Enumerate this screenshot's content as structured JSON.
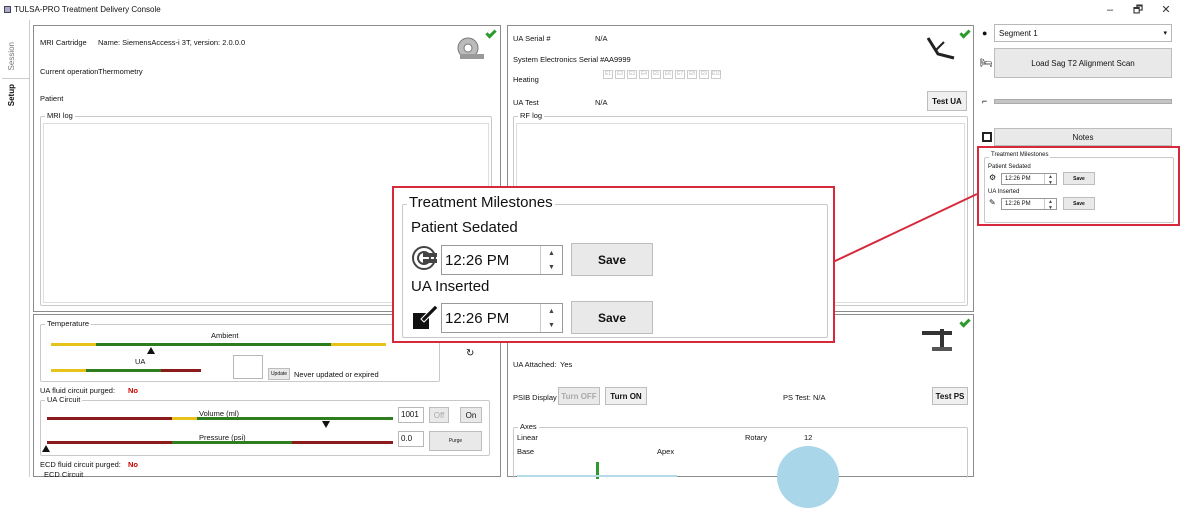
{
  "window": {
    "title": "TULSA-PRO Treatment Delivery Console",
    "minimize": "–",
    "restore": "🗗",
    "close": "✕"
  },
  "tabs": {
    "session": "Session",
    "setup": "Setup"
  },
  "mri": {
    "cartridge_label": "MRI Cartridge",
    "cartridge_value": "Name: SiemensAccess-i 3T, version: 2.0.0.0",
    "operation_label": "Current operation",
    "operation_value": "Thermometry",
    "patient_label": "Patient",
    "log_label": "MRI log"
  },
  "ua": {
    "serial_label": "UA Serial #",
    "serial_value": "N/A",
    "sys_label": "System Electronics Serial #",
    "sys_value": "AA9999",
    "heating_label": "Heating",
    "heating_channels": [
      "E1",
      "E2",
      "E3",
      "E4",
      "E5",
      "E6",
      "E7",
      "E8",
      "E9",
      "E10"
    ],
    "test_label": "UA Test",
    "test_value": "N/A",
    "test_button": "Test UA",
    "rf_log_label": "RF log"
  },
  "right": {
    "segment_value": "Segment 1",
    "load_button": "Load Sag T2 Alignment Scan",
    "notes_button": "Notes"
  },
  "milestones": {
    "title": "Treatment Milestones",
    "sedated_label": "Patient Sedated",
    "sedated_time": "12:26 PM",
    "inserted_label": "UA Inserted",
    "inserted_time": "12:26 PM",
    "save": "Save"
  },
  "temperature": {
    "title": "Temperature",
    "ambient_label": "Ambient",
    "ua_label": "UA",
    "update_button": "Update",
    "update_status": "Never updated or expired"
  },
  "fluid": {
    "ua_purged_label": "UA fluid circuit purged:",
    "ua_purged_value": "No",
    "ua_circuit_label": "UA Circuit",
    "volume_label": "Volume (ml)",
    "volume_value": "1001",
    "off_button": "Off",
    "on_button": "On",
    "pressure_label": "Pressure (psi)",
    "pressure_value": "0.0",
    "purge_button": "Purge",
    "ecd_purged_label": "ECD fluid circuit purged:",
    "ecd_purged_value": "No",
    "ecd_circuit_label": "ECD Circuit"
  },
  "ps": {
    "ua_attached_label": "UA Attached:",
    "ua_attached_value": "Yes",
    "psib_label": "PSIB Display",
    "turn_off": "Turn OFF",
    "turn_on": "Turn ON",
    "ps_test_label": "PS Test:",
    "ps_test_value": "N/A",
    "test_ps_button": "Test PS",
    "axes_label": "Axes",
    "linear_label": "Linear",
    "rotary_label": "Rotary",
    "rotary_value": "12",
    "base_label": "Base",
    "apex_label": "Apex"
  },
  "colors": {
    "red_highlight": "#d6293b",
    "green": "#2e7d1f",
    "yellow": "#e6c21a",
    "darkred": "#8b1a1a",
    "rotary_disk": "#a9d6e8"
  }
}
